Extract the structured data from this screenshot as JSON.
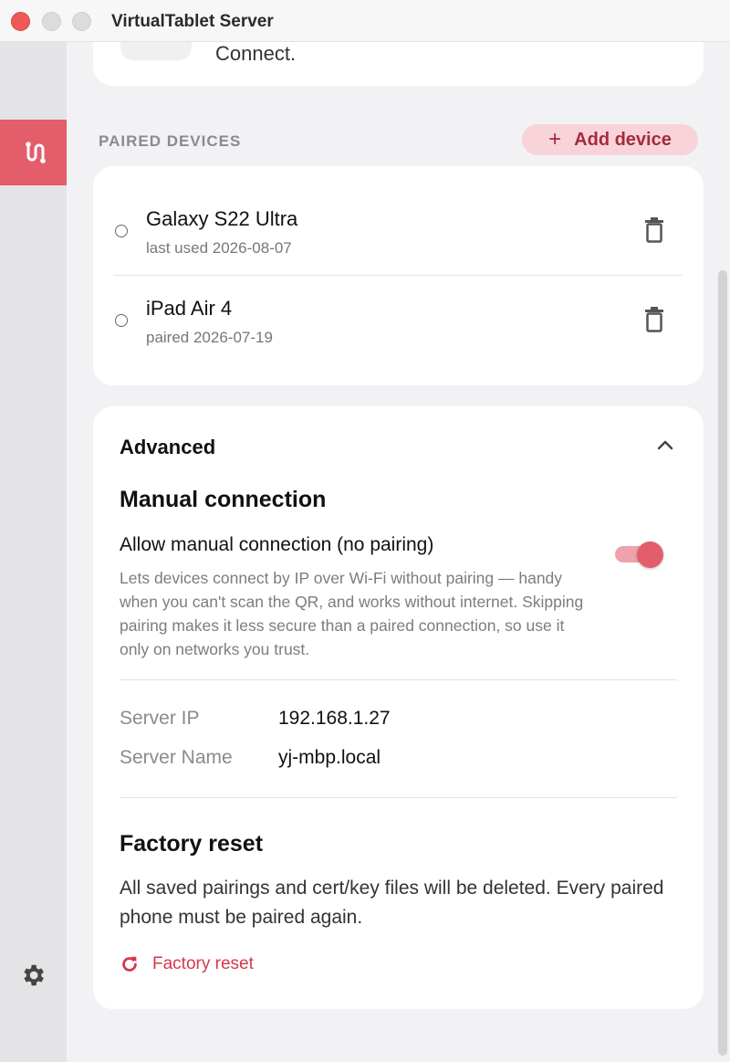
{
  "window": {
    "title": "VirtualTablet Server"
  },
  "top_card": {
    "text": "Connect."
  },
  "paired_devices": {
    "section_label": "PAIRED DEVICES",
    "add_button_label": "Add device",
    "add_button_icon": "plus-icon",
    "devices": [
      {
        "name": "Galaxy S22 Ultra",
        "sub": "last used 2026-08-07"
      },
      {
        "name": "iPad Air 4",
        "sub": "paired 2026-07-19"
      }
    ]
  },
  "advanced": {
    "title": "Advanced",
    "expanded": true,
    "manual_connection": {
      "heading": "Manual connection",
      "toggle_label": "Allow manual connection (no pairing)",
      "toggle_on": true,
      "description": "Lets devices connect by IP over Wi-Fi without pairing — handy when you can't scan the QR, and works without internet. Skipping pairing makes it less secure than a paired connection, so use it only on networks you trust."
    },
    "server": {
      "ip_label": "Server IP",
      "ip_value": "192.168.1.27",
      "name_label": "Server Name",
      "name_value": "yj-mbp.local"
    },
    "factory_reset": {
      "heading": "Factory reset",
      "description": "All saved pairings and cert/key files will be deleted. Every paired phone must be paired again.",
      "button_label": "Factory reset"
    }
  },
  "colors": {
    "accent": "#e35d6a",
    "accent_soft": "#f8d4da",
    "danger": "#d4384b"
  }
}
